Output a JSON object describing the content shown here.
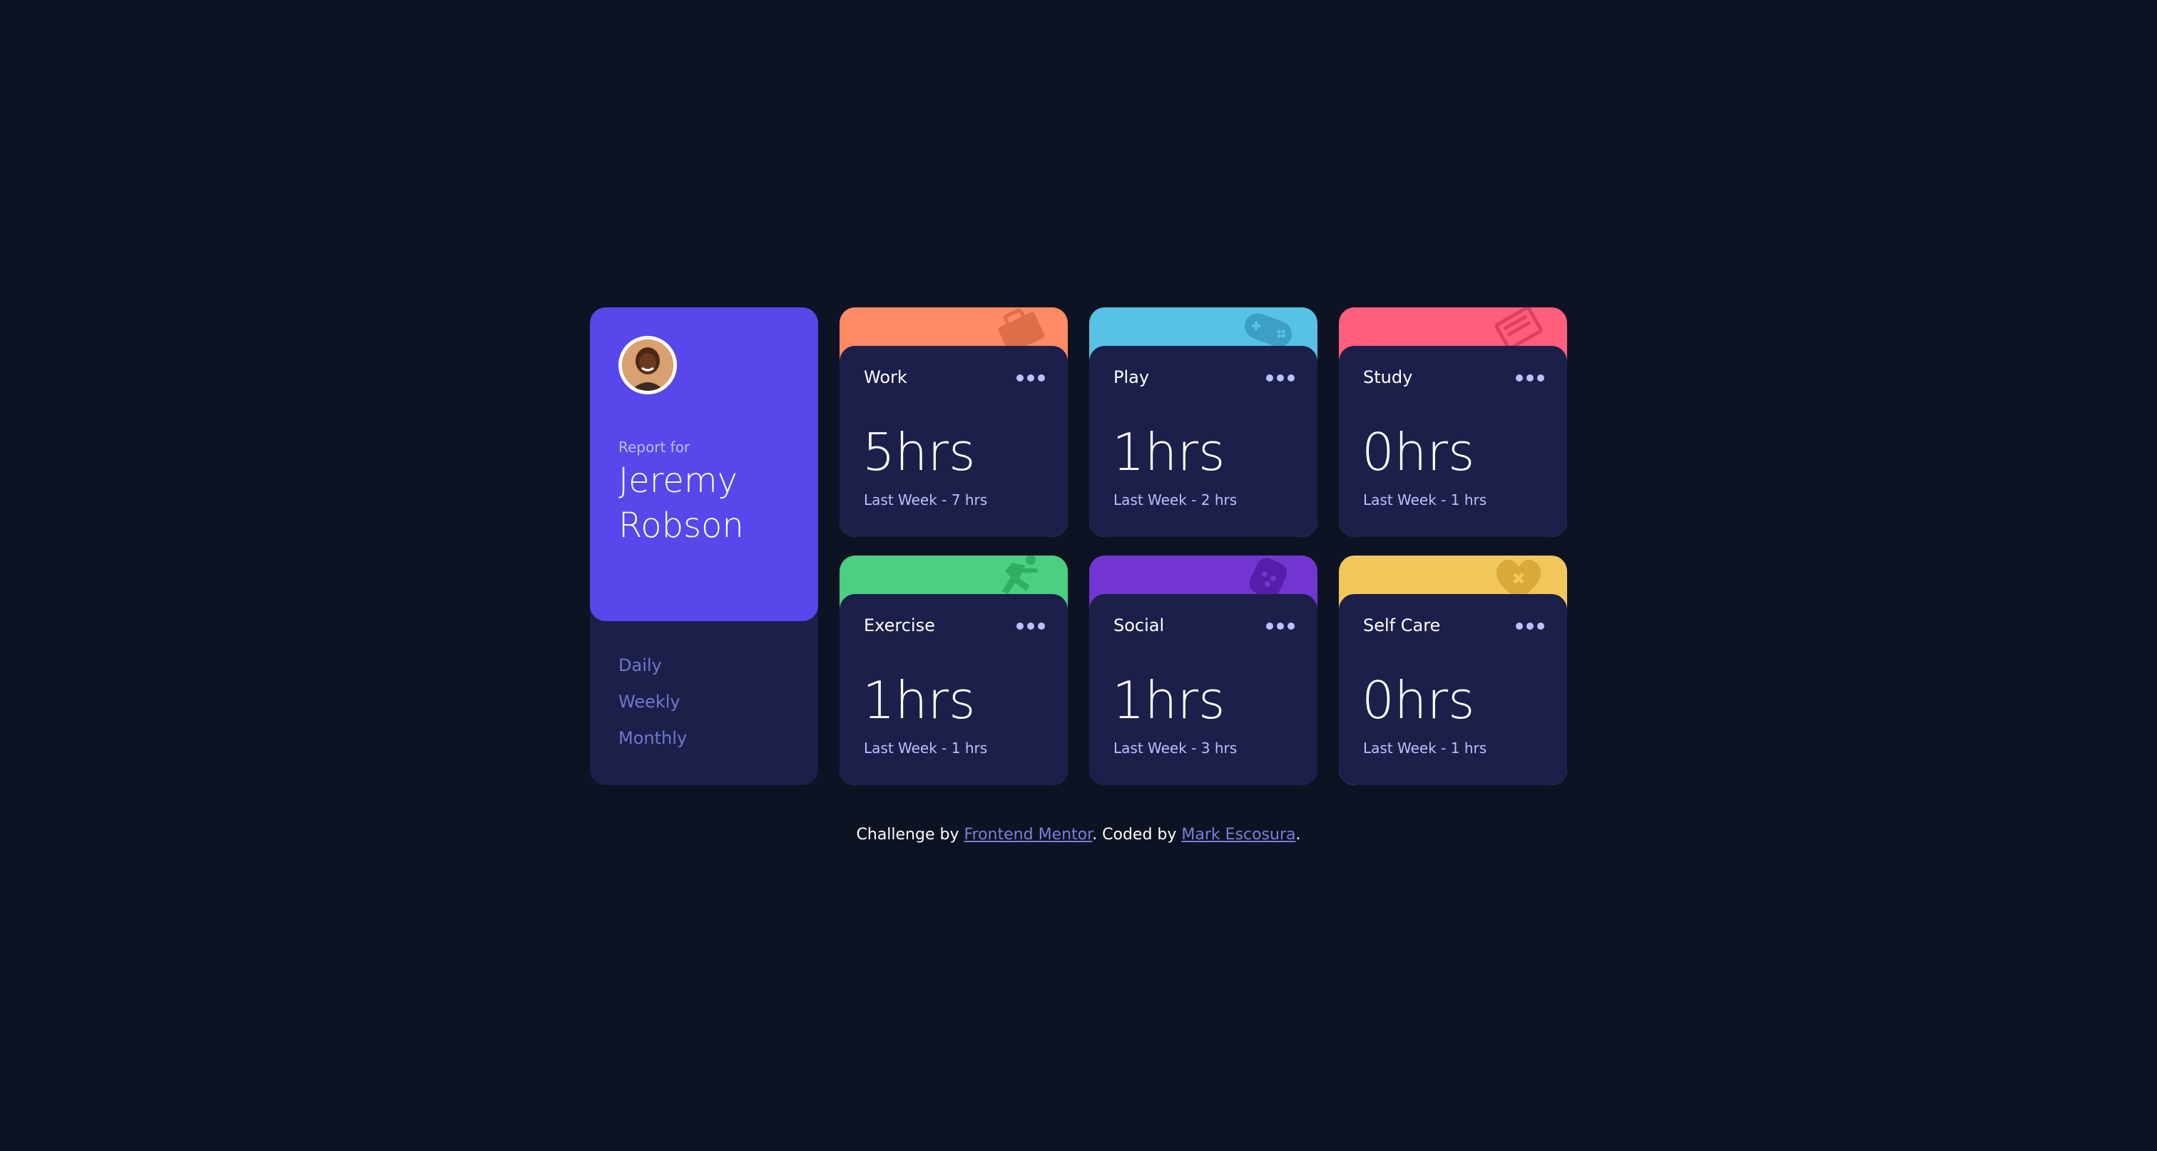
{
  "profile": {
    "report_for": "Report for",
    "name_first": "Jeremy",
    "name_last": "Robson",
    "timeframes": [
      "Daily",
      "Weekly",
      "Monthly"
    ]
  },
  "cards": [
    {
      "title": "Work",
      "hours": "5hrs",
      "previous": "Last Week - 7 hrs",
      "color": "#ff8b64",
      "icon": "work-icon"
    },
    {
      "title": "Play",
      "hours": "1hrs",
      "previous": "Last Week - 2 hrs",
      "color": "#55c2e6",
      "icon": "play-icon"
    },
    {
      "title": "Study",
      "hours": "0hrs",
      "previous": "Last Week - 1 hrs",
      "color": "#ff5e7d",
      "icon": "study-icon"
    },
    {
      "title": "Exercise",
      "hours": "1hrs",
      "previous": "Last Week - 1 hrs",
      "color": "#4bcf82",
      "icon": "exercise-icon"
    },
    {
      "title": "Social",
      "hours": "1hrs",
      "previous": "Last Week - 3 hrs",
      "color": "#7335d2",
      "icon": "social-icon"
    },
    {
      "title": "Self Care",
      "hours": "0hrs",
      "previous": "Last Week - 1 hrs",
      "color": "#f1c75b",
      "icon": "self-care-icon"
    }
  ],
  "attribution": {
    "prefix": "Challenge by ",
    "link1": "Frontend Mentor",
    "middle": ". Coded by ",
    "link2": "Mark Escosura",
    "suffix": "."
  },
  "colors": {
    "background": "#0d1323",
    "card": "#1c1f4a",
    "profile": "#5847eb",
    "muted": "#bbc0ff",
    "link": "#7078c9"
  }
}
